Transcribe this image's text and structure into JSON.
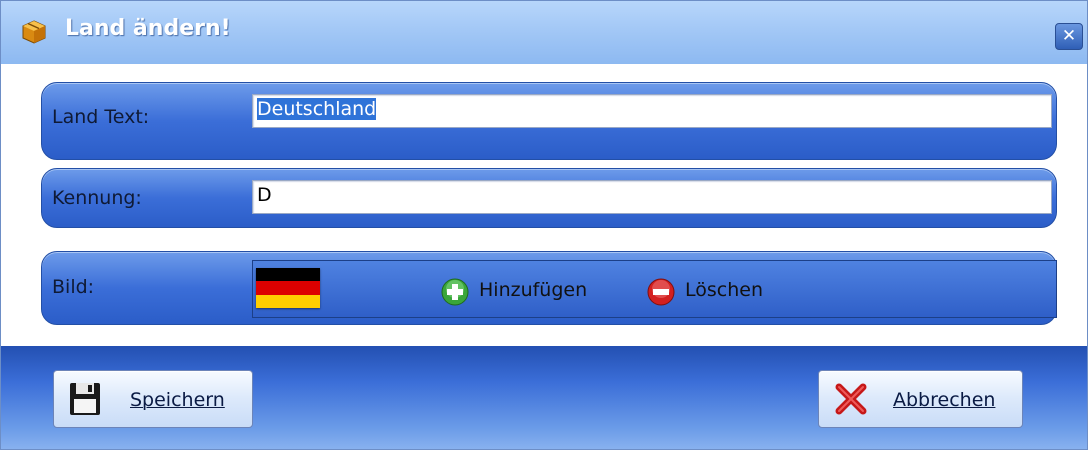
{
  "window": {
    "title": "Land ändern!",
    "title_icon": "box-icon",
    "close_icon": "close-icon",
    "close_glyph": "✕"
  },
  "fields": {
    "land_text_label": "Land Text:",
    "land_text_value": "Deutschland",
    "kennung_label": "Kennung:",
    "kennung_value": "D",
    "bild_label": "Bild:"
  },
  "picture": {
    "flag_icon": "german-flag-icon",
    "flag_colors": [
      "#000000",
      "#dd0000",
      "#ffce00"
    ],
    "add_label": "Hinzufügen",
    "add_icon": "plus-circle-icon",
    "delete_label": "Löschen",
    "delete_icon": "minus-circle-icon"
  },
  "footer": {
    "save_label": "Speichern",
    "save_icon": "floppy-disk-icon",
    "cancel_label": "Abbrechen",
    "cancel_icon": "red-x-icon"
  },
  "colors": {
    "titlebar": "#a3c8f6",
    "group": "#3b6ed8",
    "selection": "#2f73d8",
    "add_green": "#3aa63a",
    "delete_red": "#d32020"
  }
}
